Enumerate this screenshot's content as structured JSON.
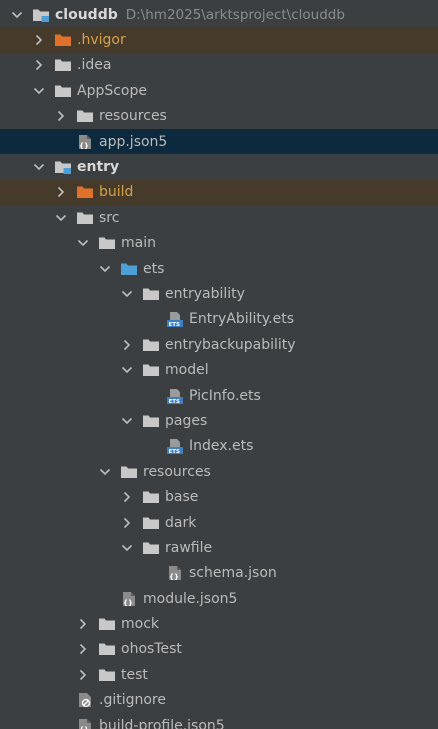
{
  "tree": {
    "items": [
      {
        "label": "clouddb",
        "path": "D:\\hm2025\\arktsproject\\clouddb"
      },
      {
        "label": ".hvigor"
      },
      {
        "label": ".idea"
      },
      {
        "label": "AppScope"
      },
      {
        "label": "resources"
      },
      {
        "label": "app.json5"
      },
      {
        "label": "entry"
      },
      {
        "label": "build"
      },
      {
        "label": "src"
      },
      {
        "label": "main"
      },
      {
        "label": "ets"
      },
      {
        "label": "entryability"
      },
      {
        "label": "EntryAbility.ets"
      },
      {
        "label": "entrybackupability"
      },
      {
        "label": "model"
      },
      {
        "label": "PicInfo.ets"
      },
      {
        "label": "pages"
      },
      {
        "label": "Index.ets"
      },
      {
        "label": "resources"
      },
      {
        "label": "base"
      },
      {
        "label": "dark"
      },
      {
        "label": "rawfile"
      },
      {
        "label": "schema.json"
      },
      {
        "label": "module.json5"
      },
      {
        "label": "mock"
      },
      {
        "label": "ohosTest"
      },
      {
        "label": "test"
      },
      {
        "label": ".gitignore"
      },
      {
        "label": "build-profile.json5"
      }
    ]
  },
  "colors": {
    "background": "#3c3f41",
    "selected_row": "#0d293e",
    "excluded_row": "#463b2b",
    "folder": "#c8c8c8",
    "excluded_folder": "#e0712b",
    "source_folder": "#4d9fd6",
    "text": "#bbbbbb",
    "path_text": "#8c8c8c"
  },
  "icons": {
    "expanded": "chevron-down-icon",
    "collapsed": "chevron-right-icon",
    "folder": "folder-icon",
    "module": "module-folder-icon",
    "json": "json-file-icon",
    "ets": "ets-file-icon",
    "gitignore": "ignore-file-icon"
  }
}
